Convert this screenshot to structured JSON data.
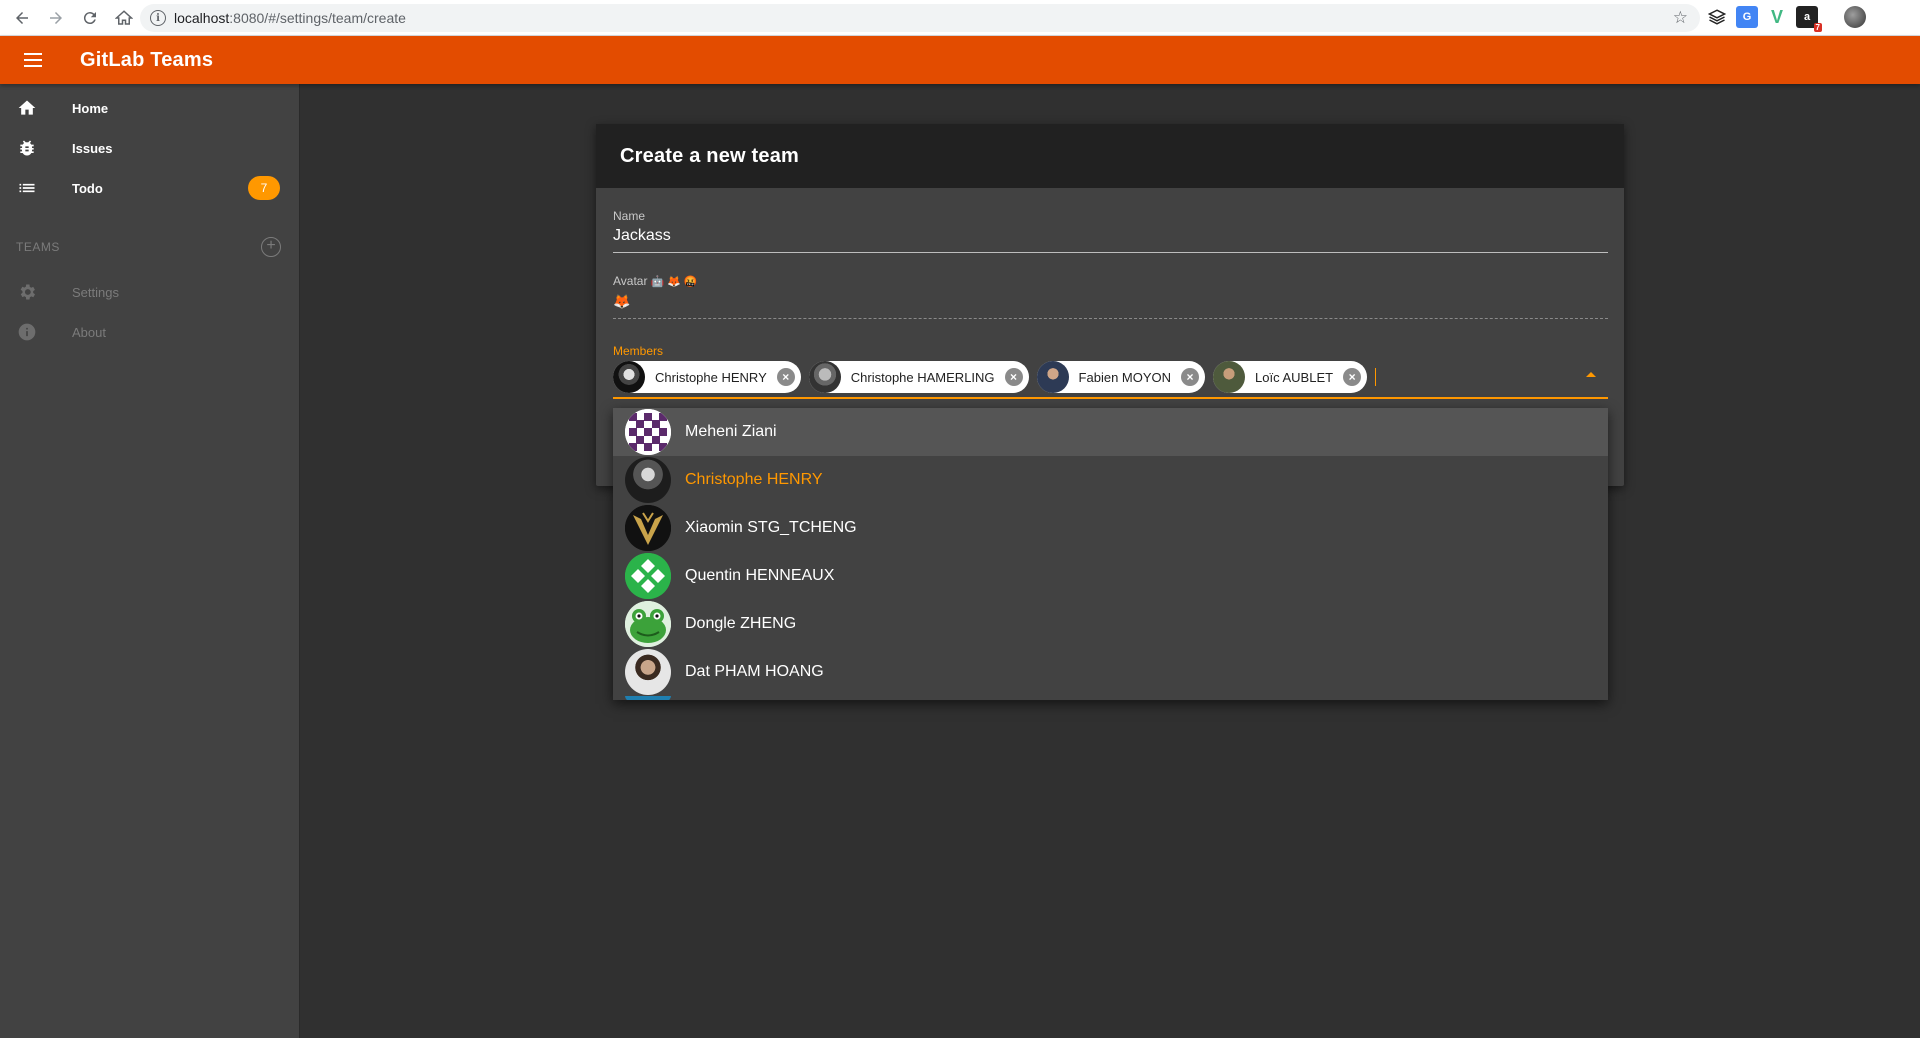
{
  "browser": {
    "url_host": "localhost",
    "url_path": ":8080/#/settings/team/create",
    "extension_badge": "7"
  },
  "app": {
    "title": "GitLab Teams"
  },
  "sidebar": {
    "items": [
      {
        "label": "Home",
        "icon": "home-icon"
      },
      {
        "label": "Issues",
        "icon": "bug-icon"
      },
      {
        "label": "Todo",
        "icon": "list-icon",
        "badge": "7"
      }
    ],
    "teams_header": "TEAMS",
    "footer_items": [
      {
        "label": "Settings",
        "icon": "gear-icon"
      },
      {
        "label": "About",
        "icon": "info-icon"
      }
    ]
  },
  "form": {
    "title": "Create a new team",
    "name_label": "Name",
    "name_value": "Jackass",
    "avatar_label": "Avatar",
    "avatar_options": [
      "🤖",
      "🦊",
      "🤬"
    ],
    "avatar_value": "🦊",
    "members_label": "Members",
    "selected_members": [
      {
        "name": "Christophe HENRY"
      },
      {
        "name": "Christophe HAMERLING"
      },
      {
        "name": "Fabien MOYON"
      },
      {
        "name": "Loïc AUBLET"
      }
    ]
  },
  "dropdown": {
    "options": [
      {
        "name": "Meheni Ziani",
        "state": "hover"
      },
      {
        "name": "Christophe HENRY",
        "state": "selected"
      },
      {
        "name": "Xiaomin STG_TCHENG",
        "state": "normal"
      },
      {
        "name": "Quentin HENNEAUX",
        "state": "normal"
      },
      {
        "name": "Dongle ZHENG",
        "state": "normal"
      },
      {
        "name": "Dat PHAM HOANG",
        "state": "normal"
      }
    ]
  },
  "colors": {
    "app_bar": "#e34c00",
    "accent": "#ff9800",
    "background": "#303030",
    "sidebar": "#424242"
  }
}
